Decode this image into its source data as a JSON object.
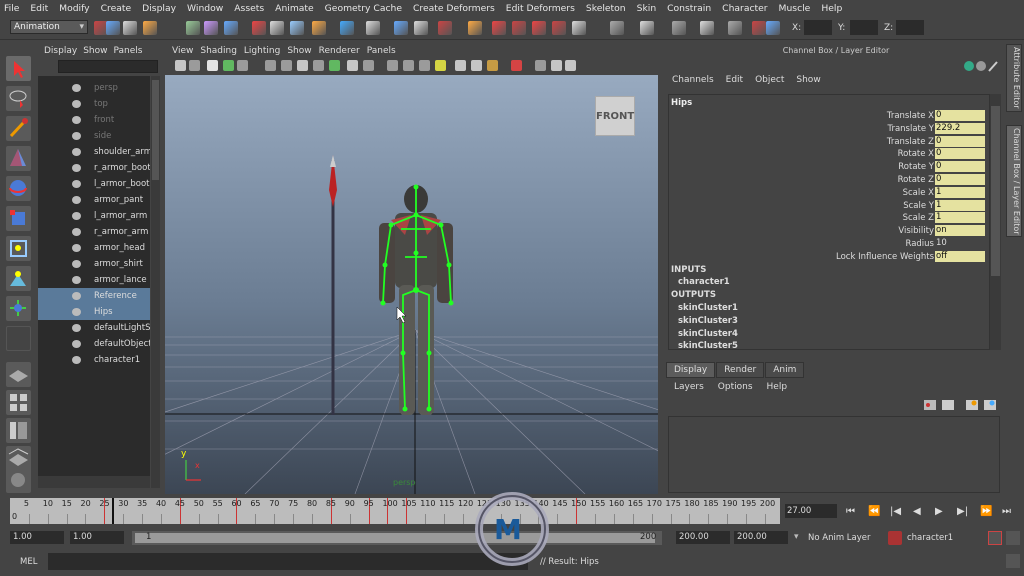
{
  "menubar": [
    "File",
    "Edit",
    "Modify",
    "Create",
    "Display",
    "Window",
    "Assets",
    "Animate",
    "Geometry Cache",
    "Create Deformers",
    "Edit Deformers",
    "Skeleton",
    "Skin",
    "Constrain",
    "Character",
    "Muscle",
    "Help"
  ],
  "mode": "Animation",
  "shelf": {
    "x_label": "X:",
    "y_label": "Y:",
    "z_label": "Z:"
  },
  "outliner": {
    "menu": [
      "Display",
      "Show",
      "Panels"
    ],
    "items": [
      {
        "label": "persp",
        "state": "dim"
      },
      {
        "label": "top",
        "state": "dim"
      },
      {
        "label": "front",
        "state": "dim"
      },
      {
        "label": "side",
        "state": "dim"
      },
      {
        "label": "shoulder_armor",
        "state": "normal"
      },
      {
        "label": "r_armor_boot",
        "state": "normal"
      },
      {
        "label": "l_armor_boot",
        "state": "normal"
      },
      {
        "label": "armor_pant",
        "state": "normal"
      },
      {
        "label": "l_armor_arm",
        "state": "normal"
      },
      {
        "label": "r_armor_arm",
        "state": "normal"
      },
      {
        "label": "armor_head",
        "state": "normal"
      },
      {
        "label": "armor_shirt",
        "state": "normal"
      },
      {
        "label": "armor_lance",
        "state": "normal"
      },
      {
        "label": "Reference",
        "state": "sel"
      },
      {
        "label": "Hips",
        "state": "sel"
      },
      {
        "label": "defaultLightSet",
        "state": "normal"
      },
      {
        "label": "defaultObjectSet",
        "state": "normal"
      },
      {
        "label": "character1",
        "state": "normal"
      }
    ]
  },
  "viewport": {
    "menu": [
      "View",
      "Shading",
      "Lighting",
      "Show",
      "Renderer",
      "Panels"
    ],
    "view_cube": "FRONT",
    "camera": "persp",
    "axis_y": "y",
    "axis_x": "x"
  },
  "channel_box": {
    "title": "Channel Box / Layer Editor",
    "menu": [
      "Channels",
      "Edit",
      "Object",
      "Show"
    ],
    "node": "Hips",
    "attrs": [
      {
        "name": "Translate X",
        "value": "0"
      },
      {
        "name": "Translate Y",
        "value": "229.2"
      },
      {
        "name": "Translate Z",
        "value": "0"
      },
      {
        "name": "Rotate X",
        "value": "0"
      },
      {
        "name": "Rotate Y",
        "value": "0"
      },
      {
        "name": "Rotate Z",
        "value": "0"
      },
      {
        "name": "Scale X",
        "value": "1"
      },
      {
        "name": "Scale Y",
        "value": "1"
      },
      {
        "name": "Scale Z",
        "value": "1"
      },
      {
        "name": "Visibility",
        "value": "on"
      },
      {
        "name": "Radius",
        "value": "10"
      },
      {
        "name": "Lock Influence Weights",
        "value": "off"
      }
    ],
    "inputs_label": "INPUTS",
    "inputs": [
      "character1"
    ],
    "outputs_label": "OUTPUTS",
    "outputs": [
      "skinCluster1",
      "skinCluster3",
      "skinCluster4",
      "skinCluster5"
    ]
  },
  "side_tabs": [
    "Attribute Editor",
    "Channel Box / Layer Editor"
  ],
  "layer_editor": {
    "tabs": [
      "Display",
      "Render",
      "Anim"
    ],
    "menu": [
      "Layers",
      "Options",
      "Help"
    ]
  },
  "timeline": {
    "ticks": [
      "5",
      "10",
      "15",
      "20",
      "25",
      "30",
      "35",
      "40",
      "45",
      "50",
      "55",
      "60",
      "65",
      "70",
      "75",
      "80",
      "85",
      "90",
      "95",
      "100",
      "105",
      "110",
      "115",
      "120",
      "125",
      "130",
      "135",
      "140",
      "145",
      "150",
      "155",
      "160",
      "165",
      "170",
      "175",
      "180",
      "185",
      "190",
      "195",
      "200"
    ],
    "start_marker": "0",
    "current_time": "27.00"
  },
  "range": {
    "start": "1.00",
    "inner_start": "1.00",
    "slider_start": "1",
    "slider_end": "200",
    "end": "200.00",
    "outer_end": "200.00",
    "anim_layer": "No Anim Layer",
    "character": "character1"
  },
  "status": {
    "mel": "MEL",
    "result": "// Result: Hips"
  }
}
